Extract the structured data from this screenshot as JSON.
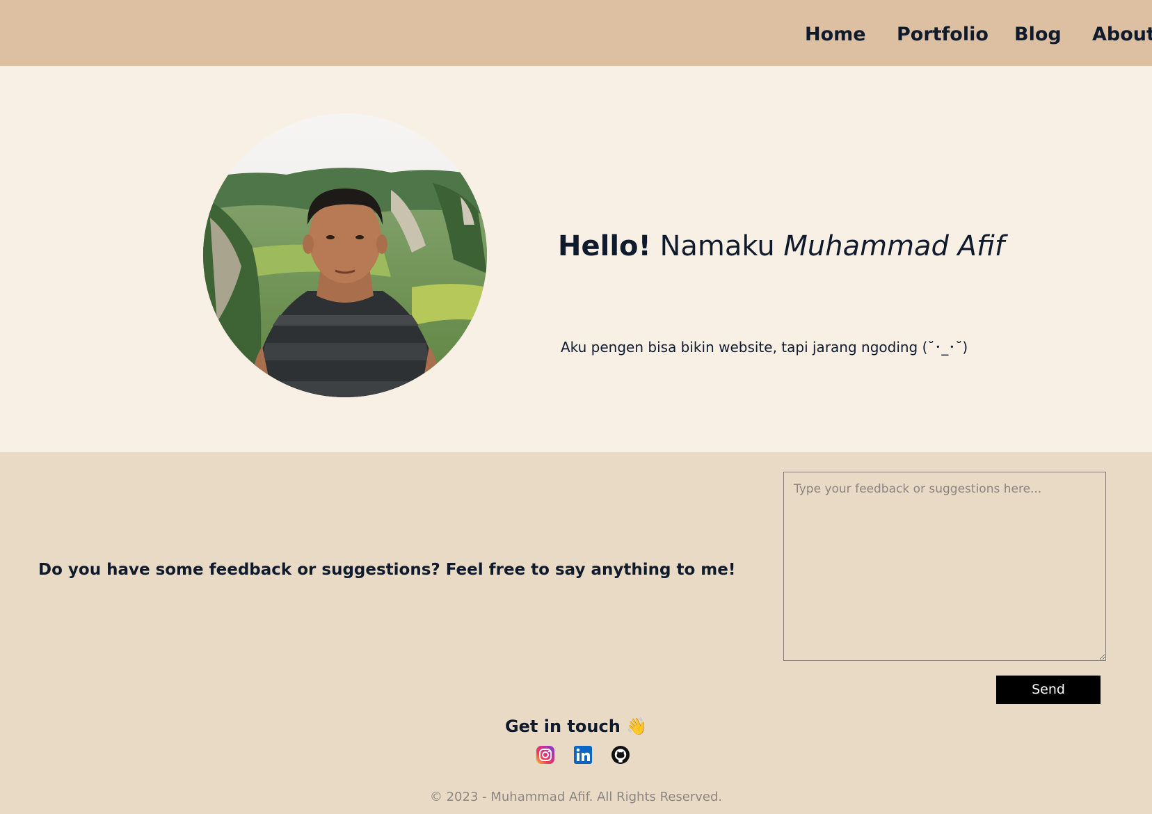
{
  "nav": {
    "items": [
      {
        "label": "Home"
      },
      {
        "label": "Portfolio"
      },
      {
        "label": "Blog"
      },
      {
        "label": "About"
      }
    ]
  },
  "hero": {
    "greeting_bold": "Hello!",
    "greeting_text": "Namaku",
    "name": "Muhammad Afif",
    "tagline": "Aku pengen bisa bikin website, tapi jarang ngoding (˘･_･˘)"
  },
  "feedback": {
    "prompt": "Do you have some feedback or suggestions? Feel free to say anything to me!",
    "placeholder": "Type your feedback or suggestions here...",
    "value": "",
    "send_label": "Send"
  },
  "contact": {
    "title": "Get in touch",
    "wave": "👋",
    "socials": [
      {
        "icon": "instagram-icon"
      },
      {
        "icon": "linkedin-icon"
      },
      {
        "icon": "github-icon"
      }
    ]
  },
  "footer": {
    "copyright": "© 2023 - Muhammad Afif. All Rights Reserved."
  },
  "colors": {
    "navbar_bg": "#dcc0a1",
    "hero_bg": "#f8efe5",
    "section_bg": "#e9dac6",
    "text": "#0f1b2d",
    "button_bg": "#000000"
  }
}
